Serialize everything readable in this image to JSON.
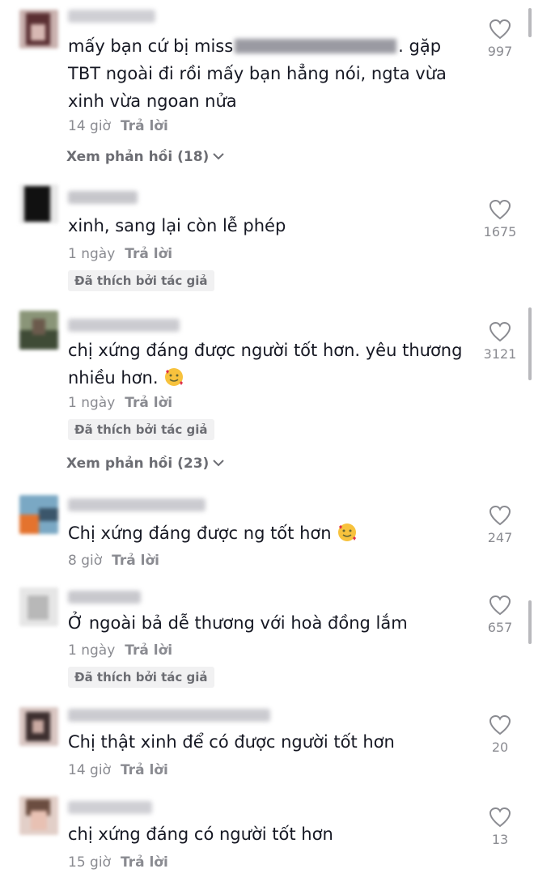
{
  "comments": [
    {
      "text_lines": [
        "mấy bạn cứ bị miss",
        "TBT ngoài đi rồi mấy bạn hẳng nói, ngta vừa",
        "xinh vừa ngoan nửa"
      ],
      "text_after_redaction": ". gặp",
      "time": "14 giờ",
      "reply": "Trả lời",
      "likes": "997",
      "view_replies": "Xem phản hồi (18)"
    },
    {
      "text": "xinh, sang lại còn lễ phép",
      "time": "1 ngày",
      "reply": "Trả lời",
      "likes": "1675",
      "liked_by_author": "Đã thích bởi tác giả"
    },
    {
      "text_lines": [
        "chị xứng đáng được người tốt hơn. yêu thương",
        "nhiều hơn."
      ],
      "emoji": "smiling-face-with-hearts",
      "time": "1 ngày",
      "reply": "Trả lời",
      "likes": "3121",
      "liked_by_author": "Đã thích bởi tác giả",
      "view_replies": "Xem phản hồi (23)"
    },
    {
      "text": "Chị xứng đáng được ng tốt hơn",
      "emoji": "smiling-face-with-hearts",
      "time": "8 giờ",
      "reply": "Trả lời",
      "likes": "247"
    },
    {
      "text": "Ở ngoài bả dễ thương với hoà đồng lắm",
      "time": "1 ngày",
      "reply": "Trả lời",
      "likes": "657",
      "liked_by_author": "Đã thích bởi tác giả"
    },
    {
      "text": "Chị thật xinh để có được người tốt hơn",
      "time": "14 giờ",
      "reply": "Trả lời",
      "likes": "20"
    },
    {
      "text": "chị xứng đáng có người tốt hơn",
      "time": "15 giờ",
      "reply": "Trả lời",
      "likes": "13"
    }
  ],
  "colors": {
    "text": "#161823",
    "secondary": "#8a8b91",
    "badge_bg": "#f1f1f2"
  },
  "icons": {
    "like": "heart-outline-icon",
    "expand": "chevron-down-icon"
  }
}
